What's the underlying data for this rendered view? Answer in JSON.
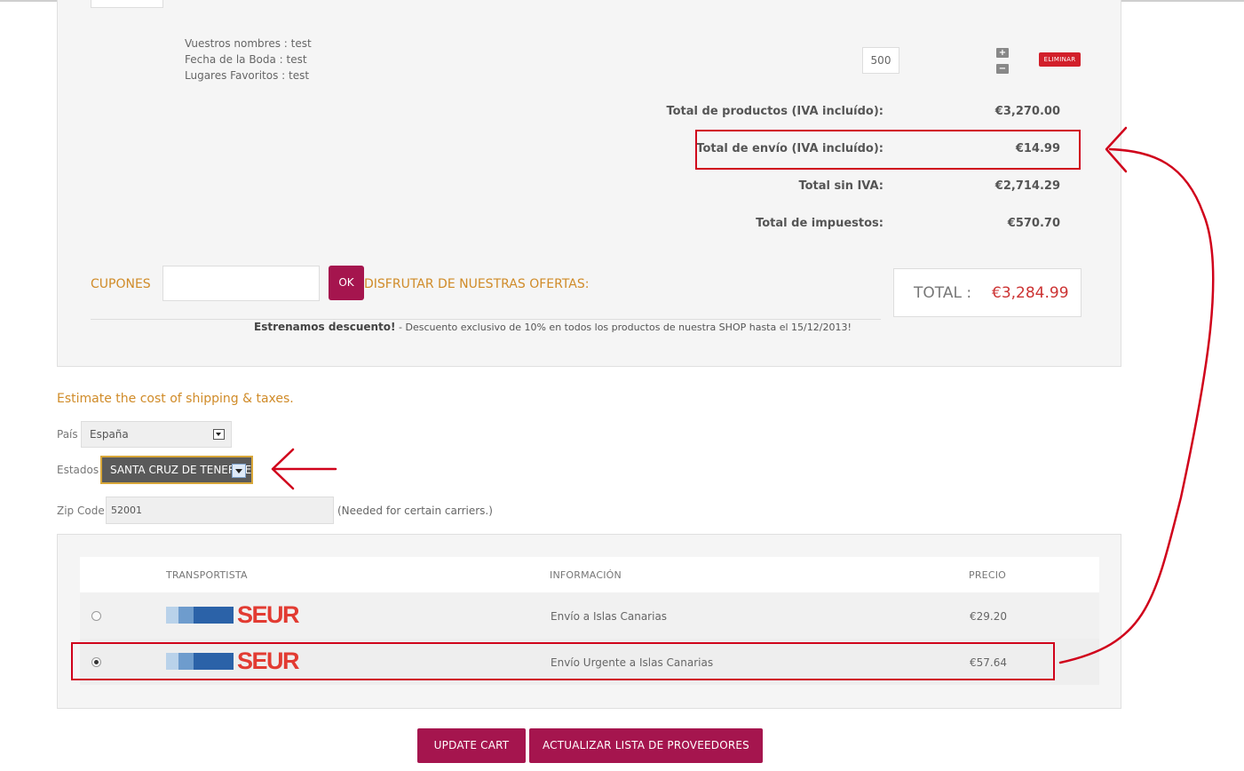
{
  "product": {
    "attributes": [
      "Vuestros nombres : test",
      "Fecha de la Boda : test",
      "Lugares Favoritos : test"
    ],
    "quantity": "500",
    "delete_label": "ELIMINAR"
  },
  "summary": {
    "products_label": "Total de productos (IVA incluído):",
    "products_value": "€3,270.00",
    "shipping_label": "Total de envío (IVA incluído):",
    "shipping_value": "€14.99",
    "net_label": "Total sin IVA:",
    "net_value": "€2,714.29",
    "tax_label": "Total de impuestos:",
    "tax_value": "€570.70"
  },
  "coupon": {
    "label": "CUPONES",
    "ok_label": "OK",
    "offers_label": "DISFRUTAR DE NUESTRAS OFERTAS:"
  },
  "total": {
    "label": "TOTAL :",
    "value": "€3,284.99"
  },
  "promo": {
    "bold": "Estrenamos descuento!",
    "text": " - Descuento exclusivo de 10% en todos los productos de nuestra SHOP hasta el 15/12/2013!"
  },
  "estimate": {
    "title": "Estimate the cost of shipping & taxes.",
    "country_label": "País",
    "country_value": "España",
    "state_label": "Estados",
    "state_value": "SANTA CRUZ DE TENERIFE",
    "zip_label": "Zip Code",
    "zip_value": "52001",
    "zip_hint": "(Needed for certain carriers.)"
  },
  "carriers": {
    "headers": [
      "TRANSPORTISTA",
      "INFORMACIÓN",
      "PRECIO"
    ],
    "rows": [
      {
        "logo_text": "SEUR",
        "info": "Envío a Islas Canarias",
        "price": "€29.20",
        "selected": false
      },
      {
        "logo_text": "SEUR",
        "info": "Envío Urgente a Islas Canarias",
        "price": "€57.64",
        "selected": true
      }
    ]
  },
  "buttons": {
    "update_cart": "UPDATE CART",
    "update_carriers": "ACTUALIZAR LISTA DE PROVEEDORES"
  },
  "colors": {
    "accent": "#a5154e",
    "label_orange": "#d08b28",
    "highlight_red": "#d0021b"
  }
}
